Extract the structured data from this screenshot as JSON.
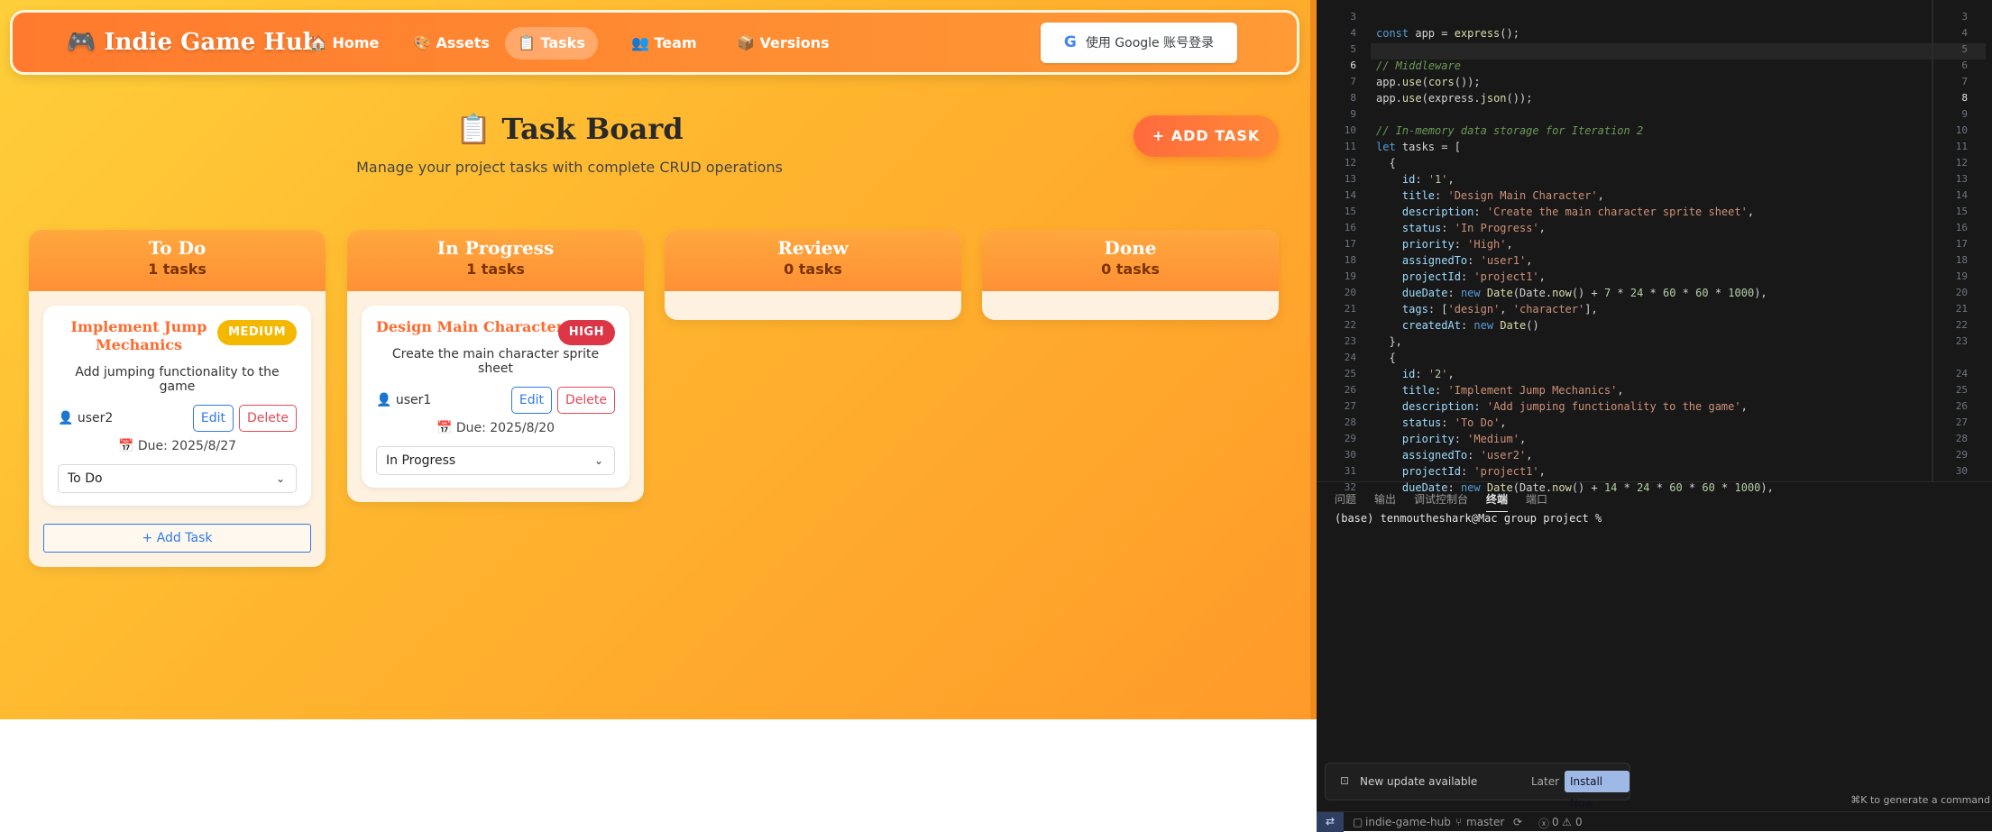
{
  "app": {
    "brand": "🎮 Indie Game Hub",
    "nav": [
      {
        "icon": "🏠",
        "label": "Home"
      },
      {
        "icon": "🎨",
        "label": "Assets"
      },
      {
        "icon": "📋",
        "label": "Tasks"
      },
      {
        "icon": "👥",
        "label": "Team"
      },
      {
        "icon": "📦",
        "label": "Versions"
      }
    ],
    "login_label": "使用 Google 账号登录",
    "board_title": "📋 Task Board",
    "board_subtitle": "Manage your project tasks with complete CRUD operations",
    "add_task_top": "+ ADD TASK",
    "columns": [
      {
        "name": "To Do",
        "count": "1 tasks"
      },
      {
        "name": "In Progress",
        "count": "1 tasks"
      },
      {
        "name": "Review",
        "count": "0 tasks"
      },
      {
        "name": "Done",
        "count": "0 tasks"
      }
    ],
    "cards": [
      {
        "title": "Implement Jump Mechanics",
        "priority": "MEDIUM",
        "priority_color": "#f5b800",
        "description": "Add jumping functionality to the game",
        "assignee": "👤 user2",
        "edit": "Edit",
        "delete": "Delete",
        "due": "📅 Due: 2025/8/27",
        "status": "To Do"
      },
      {
        "title": "Design Main Character",
        "priority": "HIGH",
        "priority_color": "#dc3545",
        "description": "Create the main character sprite sheet",
        "assignee": "👤 user1",
        "edit": "Edit",
        "delete": "Delete",
        "due": "📅 Due: 2025/8/20",
        "status": "In Progress"
      }
    ],
    "add_task_column": "+ Add Task"
  },
  "editor": {
    "line_numbers": [
      "3",
      "4",
      "5",
      "6",
      "7",
      "8",
      "9",
      "10",
      "11",
      "12",
      "13",
      "14",
      "15",
      "16",
      "17",
      "18",
      "19",
      "20",
      "21",
      "22",
      "23",
      "24",
      "25",
      "26",
      "27",
      "28",
      "29",
      "30",
      "31",
      "32"
    ],
    "current_line": "6",
    "code": [
      "",
      "const app = express();",
      "",
      "// Middleware",
      "app.use(cors());",
      "app.use(express.json());",
      "",
      "// In-memory data storage for Iteration 2",
      "let tasks = [",
      "  {",
      "    id: '1',",
      "    title: 'Design Main Character',",
      "    description: 'Create the main character sprite sheet',",
      "    status: 'In Progress',",
      "    priority: 'High',",
      "    assignedTo: 'user1',",
      "    projectId: 'project1',",
      "    dueDate: new Date(Date.now() + 7 * 24 * 60 * 60 * 1000),",
      "    tags: ['design', 'character'],",
      "    createdAt: new Date()",
      "  },",
      "  {",
      "    id: '2',",
      "    title: 'Implement Jump Mechanics',",
      "    description: 'Add jumping functionality to the game',",
      "    status: 'To Do',",
      "    priority: 'Medium',",
      "    assignedTo: 'user2',",
      "    projectId: 'project1',",
      "    dueDate: new Date(Date.now() + 14 * 24 * 60 * 60 * 1000),"
    ],
    "side_line_numbers": [
      "3",
      "4",
      "5",
      "6",
      "7",
      "8",
      "9",
      "10",
      "11",
      "12",
      "13",
      "14",
      "15",
      "16",
      "17",
      "18",
      "19",
      "20",
      "21",
      "22",
      "23",
      "",
      "24",
      "25",
      "26",
      "27",
      "28",
      "29",
      "30"
    ],
    "side_current": "8",
    "panel_tabs": [
      "问题",
      "输出",
      "调试控制台",
      "终端",
      "端口"
    ],
    "active_tab": "终端",
    "terminal_prompt": "(base) tenmoutheshark@Mac group project %",
    "toast": {
      "text": "New update available",
      "later": "Later",
      "install": "Install Now"
    },
    "cmdk_hint": "⌘K to generate a command",
    "statusbar": {
      "repo": "indie-game-hub",
      "branch": "master",
      "errors": "0",
      "warnings": "0"
    }
  }
}
